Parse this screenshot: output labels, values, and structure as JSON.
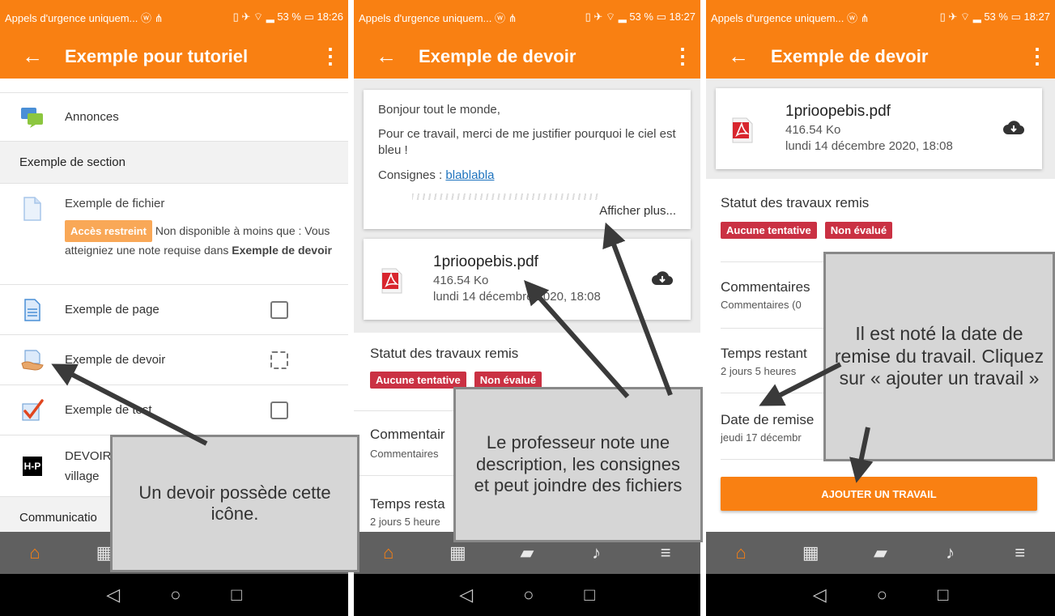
{
  "panels": [
    {
      "status": {
        "left": "Appels d'urgence uniquem... ⓦ ⋔",
        "right": "▯ ✈ ⌔ ▂ 53 % ▭ 18:26"
      },
      "title": "Exemple pour tutoriel",
      "items": {
        "annonces": "Annonces",
        "section": "Exemple de section",
        "fichier": "Exemple de fichier",
        "restricted_badge": "Accès restreint",
        "restricted_text": " Non disponible à moins que : Vous atteigniez une note requise dans ",
        "restricted_bold": "Exemple de devoir",
        "page": "Exemple de page",
        "devoir": "Exemple de devoir",
        "test": "Exemple de test",
        "h5p_line1": "DEVOIR",
        "h5p_line2": "village",
        "communication": "Communicatio",
        "h5p_logo": "H-P"
      },
      "callout": "Un devoir possède cette icône."
    },
    {
      "status": {
        "left": "Appels d'urgence uniquem... ⓦ ⋔",
        "right": "▯ ✈ ⌔ ▂ 53 % ▭ 18:27"
      },
      "title": "Exemple de devoir",
      "desc": {
        "greeting": "Bonjour tout le monde,",
        "body": "Pour ce travail, merci de me justifier pourquoi le ciel est bleu !",
        "consignes_label": "Consignes : ",
        "consignes_link": "blablabla",
        "more": "Afficher plus..."
      },
      "file": {
        "name": "1prioopebis.pdf",
        "size": "416.54 Ko",
        "date": "lundi 14 décembre 2020, 18:08"
      },
      "status_title": "Statut des travaux remis",
      "badges": [
        "Aucune tentative",
        "Non évalué"
      ],
      "comments_title": "Commentair",
      "comments_sub": "Commentaires",
      "time_title": "Temps resta",
      "time_sub": "2 jours 5 heure",
      "callout": "Le professeur note une description, les consignes et peut joindre des fichiers"
    },
    {
      "status": {
        "left": "Appels d'urgence uniquem... ⓦ ⋔",
        "right": "▯ ✈ ⌔ ▂ 53 % ▭ 18:27"
      },
      "title": "Exemple de devoir",
      "file": {
        "name": "1prioopebis.pdf",
        "size": "416.54 Ko",
        "date": "lundi 14 décembre 2020, 18:08"
      },
      "status_title": "Statut des travaux remis",
      "badges": [
        "Aucune tentative",
        "Non évalué"
      ],
      "comments_title": "Commentaires",
      "comments_sub": "Commentaires (0",
      "time_title": "Temps restant",
      "time_sub": "2 jours 5 heures",
      "due_title": "Date de remise",
      "due_sub": "jeudi 17 décembr",
      "button": "AJOUTER UN TRAVAIL",
      "callout": "Il est noté la date de remise du travail. Cliquez sur « ajouter un travail »"
    }
  ],
  "colors": {
    "brand": "#f98012",
    "badge_red": "#ca3143",
    "badge_orange": "#f9a857"
  }
}
